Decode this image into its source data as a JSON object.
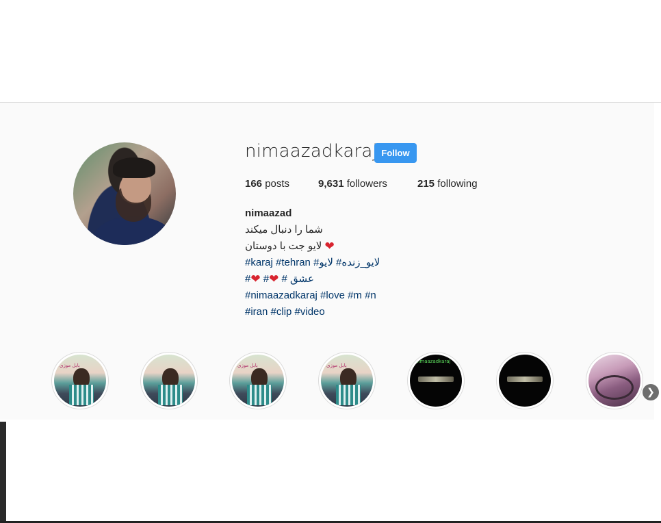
{
  "profile": {
    "username": "nimaazadkaraj",
    "follow_label": "Follow",
    "stats": {
      "posts_count": "166",
      "posts_label": "posts",
      "followers_count": "9,631",
      "followers_label": "followers",
      "following_count": "215",
      "following_label": "following"
    },
    "bio": {
      "full_name": "nimaazad",
      "line1": "شما را دنبال میکند",
      "line2": "لایو جت با دوستان",
      "line3": "#karaj #tehran #لایو_زنده# لایو",
      "line4a": "#",
      "line4b": "#",
      "line4c": "# عشق",
      "line5": "#nimaazadkaraj #love #m #n",
      "line6": "#iran #clip #video"
    }
  },
  "highlights": [
    {
      "kind": "photo",
      "caption": "بابل موزی"
    },
    {
      "kind": "photo",
      "caption": ""
    },
    {
      "kind": "photo",
      "caption": "بابل موزی"
    },
    {
      "kind": "photo",
      "caption": "بابل موزی"
    },
    {
      "kind": "dark",
      "caption": "nimaazadkaraj"
    },
    {
      "kind": "dark",
      "caption": ""
    },
    {
      "kind": "car",
      "caption": ""
    }
  ],
  "icons": {
    "heart": "heart-icon",
    "next": "chevron-right-icon"
  },
  "colors": {
    "follow_button": "#3897f0",
    "hashtag": "#003569",
    "heart": "#d8242f",
    "page_background": "#fafafa"
  }
}
